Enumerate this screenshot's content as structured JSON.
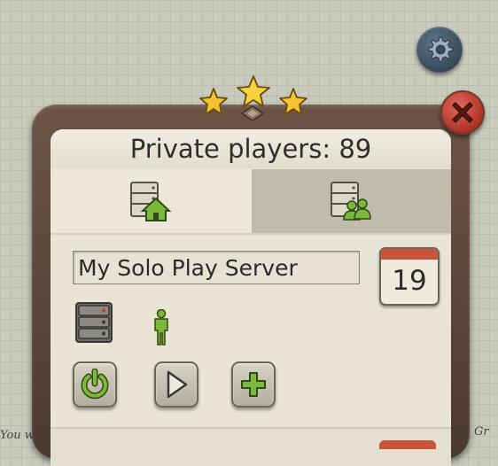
{
  "header": {
    "title": "Private players: 89"
  },
  "tabs": [
    {
      "icon": "server-home-icon",
      "selected": true
    },
    {
      "icon": "server-group-icon",
      "selected": false
    }
  ],
  "server": {
    "name": "My Solo Play Server",
    "calendar_day": "19",
    "player_count": 1
  },
  "actions": [
    {
      "icon": "power-icon"
    },
    {
      "icon": "play-icon"
    },
    {
      "icon": "plus-icon"
    }
  ],
  "rating": {
    "stars": 3
  },
  "background": {
    "text_left": "You w",
    "text_right": "Gr"
  },
  "colors": {
    "accent_green": "#7cb83a",
    "close_red": "#c0392b",
    "frame_brown": "#5a4538",
    "calendar_red": "#c8553a"
  }
}
